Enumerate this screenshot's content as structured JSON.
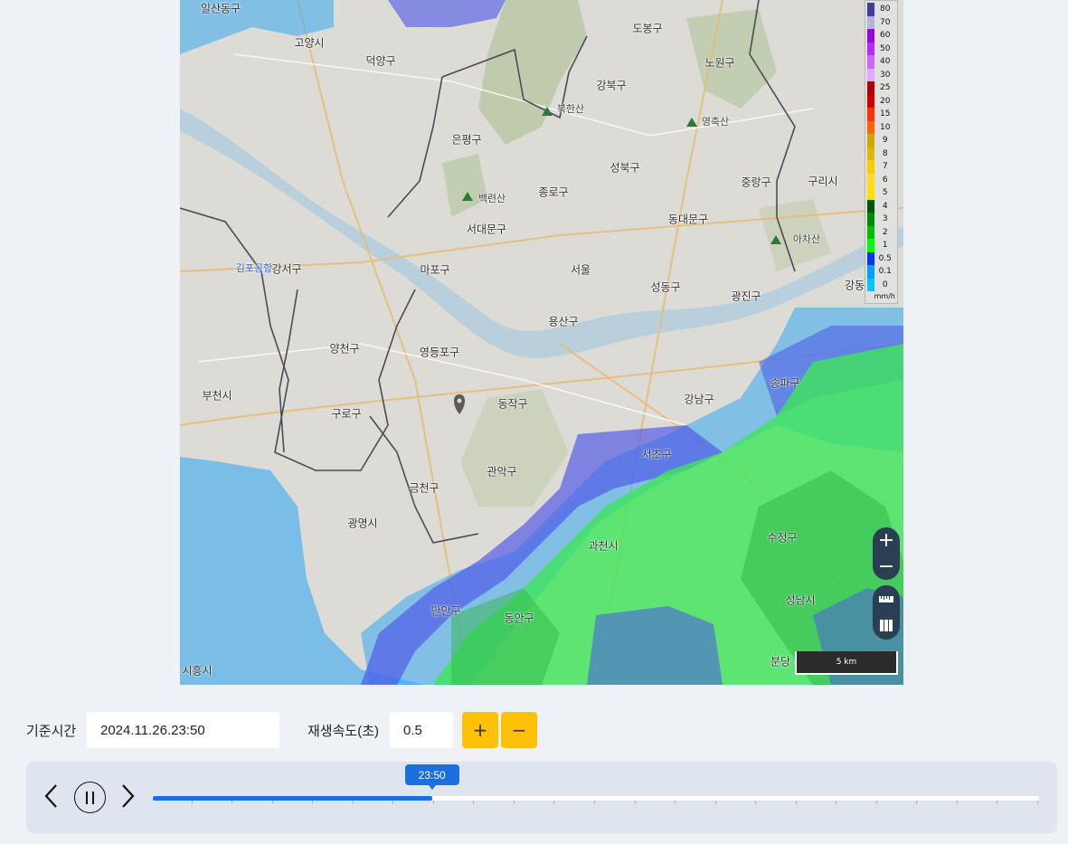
{
  "map": {
    "place_labels": [
      {
        "text": "일산동구",
        "cls": "big"
      },
      {
        "text": "고양시",
        "cls": "big"
      },
      {
        "text": "덕양구",
        "cls": "big"
      },
      {
        "text": "도봉구",
        "cls": "big"
      },
      {
        "text": "노원구",
        "cls": "big"
      },
      {
        "text": "강북구",
        "cls": "big"
      },
      {
        "text": "북한산",
        "cls": ""
      },
      {
        "text": "영축산",
        "cls": ""
      },
      {
        "text": "은평구",
        "cls": "big"
      },
      {
        "text": "성북구",
        "cls": "big"
      },
      {
        "text": "중랑구",
        "cls": "big"
      },
      {
        "text": "구리시",
        "cls": "big"
      },
      {
        "text": "백련산",
        "cls": ""
      },
      {
        "text": "종로구",
        "cls": "big"
      },
      {
        "text": "동대문구",
        "cls": "big"
      },
      {
        "text": "서대문구",
        "cls": "big"
      },
      {
        "text": "아차산",
        "cls": ""
      },
      {
        "text": "김포공항",
        "cls": "blue"
      },
      {
        "text": "강서구",
        "cls": "big"
      },
      {
        "text": "마포구",
        "cls": "big"
      },
      {
        "text": "서울",
        "cls": "big"
      },
      {
        "text": "성동구",
        "cls": "big"
      },
      {
        "text": "광진구",
        "cls": "big"
      },
      {
        "text": "강동",
        "cls": "big"
      },
      {
        "text": "용산구",
        "cls": "big"
      },
      {
        "text": "양천구",
        "cls": "big"
      },
      {
        "text": "영등포구",
        "cls": "big"
      },
      {
        "text": "송파구",
        "cls": "big"
      },
      {
        "text": "부천시",
        "cls": "big"
      },
      {
        "text": "동작구",
        "cls": "big"
      },
      {
        "text": "강남구",
        "cls": "big"
      },
      {
        "text": "구로구",
        "cls": "big"
      },
      {
        "text": "서초구",
        "cls": "big"
      },
      {
        "text": "관악구",
        "cls": "big"
      },
      {
        "text": "금천구",
        "cls": "big"
      },
      {
        "text": "과천시",
        "cls": "big"
      },
      {
        "text": "수정구",
        "cls": "big"
      },
      {
        "text": "광명시",
        "cls": "big"
      },
      {
        "text": "만안구",
        "cls": "big"
      },
      {
        "text": "동안구",
        "cls": "big"
      },
      {
        "text": "성남시",
        "cls": "big"
      },
      {
        "text": "분당",
        "cls": "big"
      },
      {
        "text": "시흥시",
        "cls": "big"
      }
    ],
    "legend": {
      "unit": "mm/h",
      "items": [
        {
          "value": "80",
          "color": "#3f3f9f"
        },
        {
          "value": "70",
          "color": "#b3b4de"
        },
        {
          "value": "60",
          "color": "#9b00e0"
        },
        {
          "value": "50",
          "color": "#b329ff"
        },
        {
          "value": "40",
          "color": "#c969ff"
        },
        {
          "value": "30",
          "color": "#dfa9ff"
        },
        {
          "value": "25",
          "color": "#b40000"
        },
        {
          "value": "20",
          "color": "#d20000"
        },
        {
          "value": "15",
          "color": "#ff3200"
        },
        {
          "value": "10",
          "color": "#ff6600"
        },
        {
          "value": "9",
          "color": "#ccaa00"
        },
        {
          "value": "8",
          "color": "#e0b900"
        },
        {
          "value": "7",
          "color": "#f9cb00"
        },
        {
          "value": "6",
          "color": "#ffdc1f"
        },
        {
          "value": "5",
          "color": "#ffe100"
        },
        {
          "value": "4",
          "color": "#005a00"
        },
        {
          "value": "3",
          "color": "#008c00"
        },
        {
          "value": "2",
          "color": "#00be00"
        },
        {
          "value": "1",
          "color": "#00ff00"
        },
        {
          "value": "0.5",
          "color": "#0033f5"
        },
        {
          "value": "0.1",
          "color": "#00a0ff"
        },
        {
          "value": "0",
          "color": "#00c8ff"
        }
      ]
    },
    "zoom_in": "+",
    "zoom_out": "−",
    "scale_label": "5 km"
  },
  "controls": {
    "base_time_label": "기준시간",
    "base_time_value": "2024.11.26.23:50",
    "speed_label": "재생속도(초)",
    "speed_value": "0.5",
    "speed_plus": "+",
    "speed_minus": "−"
  },
  "player": {
    "current_time": "23:50",
    "progress": 0.315
  }
}
